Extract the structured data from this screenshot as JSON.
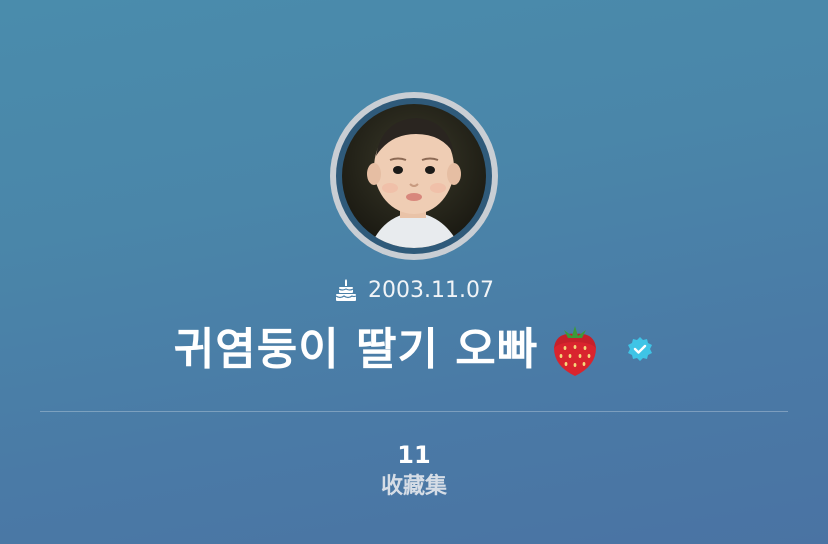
{
  "profile": {
    "avatar_alt": "profile photo",
    "birthday": "2003.11.07",
    "display_name": "귀염둥이 딸기 오빠",
    "name_emoji": "strawberry-icon",
    "verified": true
  },
  "stats": {
    "collections_count": "11",
    "collections_label": "收藏集"
  },
  "colors": {
    "background_top": "#4a8cac",
    "background_bottom": "#4a73a3",
    "verified_badge": "#3fc4e6",
    "avatar_ring": "#c9ced4"
  }
}
